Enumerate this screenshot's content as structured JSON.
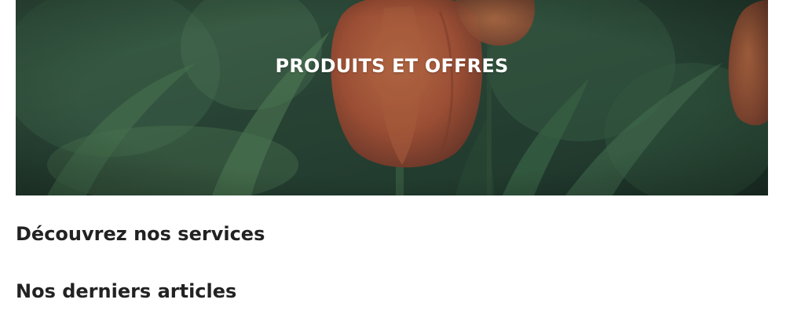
{
  "banner": {
    "title": "PRODUITS ET OFFRES",
    "image_subject": "orange tulips among green leaves"
  },
  "sections": {
    "services_heading": "Découvrez nos services",
    "articles_heading": "Nos derniers articles"
  },
  "colors": {
    "heading_text": "#222222",
    "banner_text": "#ffffff",
    "foliage_dark": "#243d30",
    "foliage_mid": "#3f6b4b",
    "tulip_orange": "#c8663d"
  }
}
